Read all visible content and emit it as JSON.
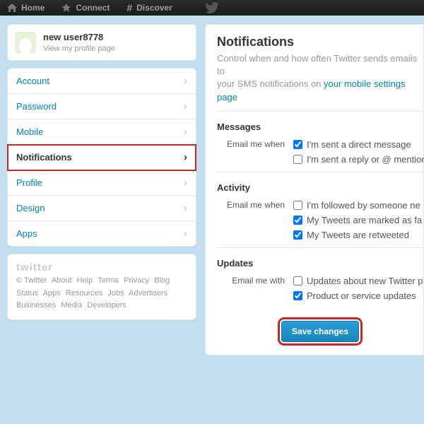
{
  "topbar": {
    "home": "Home",
    "connect": "Connect",
    "discover": "Discover"
  },
  "profile": {
    "name": "new user8778",
    "sub": "View my profile page"
  },
  "nav": [
    "Account",
    "Password",
    "Mobile",
    "Notifications",
    "Profile",
    "Design",
    "Apps"
  ],
  "footer": {
    "logo": "twitter",
    "links": [
      "© Twitter",
      "About",
      "Help",
      "Terms",
      "Privacy",
      "Blog",
      "Status",
      "Apps",
      "Resources",
      "Jobs",
      "Advertisers",
      "Businesses",
      "Media",
      "Developers"
    ]
  },
  "main": {
    "title": "Notifications",
    "desc_pre": "Control when and how often Twitter sends emails to",
    "desc_mid": "your SMS notifications on ",
    "desc_link": "your mobile settings page",
    "sections": {
      "messages": {
        "heading": "Messages",
        "label": "Email me when",
        "opts": [
          {
            "text": "I'm sent a direct message",
            "checked": true
          },
          {
            "text": "I'm sent a reply or @ mention",
            "checked": false
          }
        ]
      },
      "activity": {
        "heading": "Activity",
        "label": "Email me when",
        "opts": [
          {
            "text": "I'm followed by someone ne",
            "checked": false
          },
          {
            "text": "My Tweets are marked as fa",
            "checked": true
          },
          {
            "text": "My Tweets are retweeted",
            "checked": true
          }
        ]
      },
      "updates": {
        "heading": "Updates",
        "label": "Email me with",
        "opts": [
          {
            "text": "Updates about new Twitter p",
            "checked": false
          },
          {
            "text": "Product or service updates",
            "checked": true
          }
        ]
      }
    },
    "save": "Save changes"
  }
}
